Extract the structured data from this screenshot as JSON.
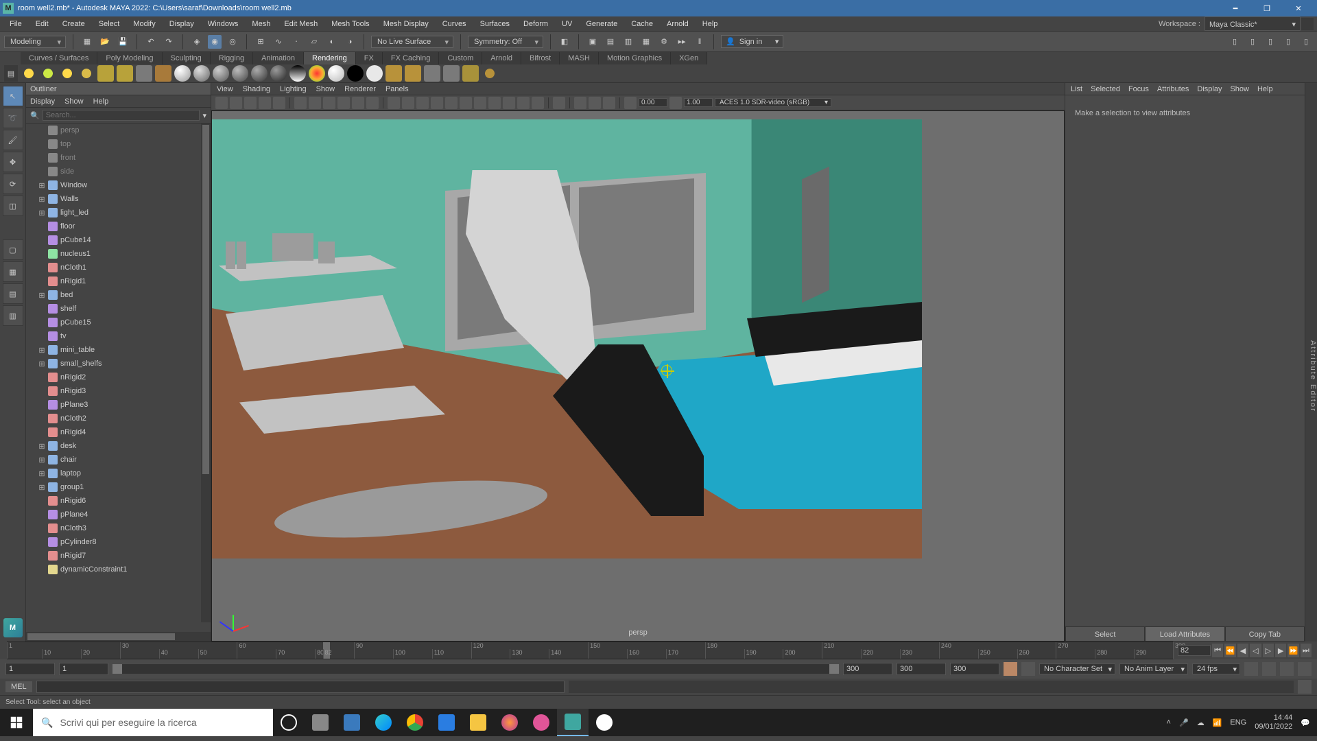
{
  "titlebar": {
    "title": "room well2.mb* - Autodesk MAYA 2022: C:\\Users\\saraf\\Downloads\\room well2.mb",
    "app_icon_letter": "M"
  },
  "menus": [
    "File",
    "Edit",
    "Create",
    "Select",
    "Modify",
    "Display",
    "Windows",
    "Mesh",
    "Edit Mesh",
    "Mesh Tools",
    "Mesh Display",
    "Curves",
    "Surfaces",
    "Deform",
    "UV",
    "Generate",
    "Cache",
    "Arnold",
    "Help"
  ],
  "workspace": {
    "label": "Workspace :",
    "value": "Maya Classic*"
  },
  "statusline": {
    "mode": "Modeling",
    "live": "No Live Surface",
    "symmetry": "Symmetry: Off",
    "signin": "Sign in"
  },
  "shelf_tabs": [
    "Curves / Surfaces",
    "Poly Modeling",
    "Sculpting",
    "Rigging",
    "Animation",
    "Rendering",
    "FX",
    "FX Caching",
    "Custom",
    "Arnold",
    "Bifrost",
    "MASH",
    "Motion Graphics",
    "XGen"
  ],
  "shelf_active_idx": 5,
  "outliner": {
    "title": "Outliner",
    "menus": [
      "Display",
      "Show",
      "Help"
    ],
    "search_placeholder": "Search...",
    "nodes": [
      {
        "exp": "",
        "cls": "cam",
        "name": "persp"
      },
      {
        "exp": "",
        "cls": "cam",
        "name": "top"
      },
      {
        "exp": "",
        "cls": "cam",
        "name": "front"
      },
      {
        "exp": "",
        "cls": "cam",
        "name": "side"
      },
      {
        "exp": "⊞",
        "cls": "grp",
        "name": "Window"
      },
      {
        "exp": "⊞",
        "cls": "grp",
        "name": "Walls"
      },
      {
        "exp": "⊞",
        "cls": "grp",
        "name": "light_led"
      },
      {
        "exp": "",
        "cls": "mesh",
        "name": "floor"
      },
      {
        "exp": "",
        "cls": "mesh",
        "name": "pCube14"
      },
      {
        "exp": "",
        "cls": "nuc",
        "name": "nucleus1"
      },
      {
        "exp": "",
        "cls": "phys",
        "name": "nCloth1"
      },
      {
        "exp": "",
        "cls": "phys",
        "name": "nRigid1"
      },
      {
        "exp": "⊞",
        "cls": "grp",
        "name": "bed"
      },
      {
        "exp": "",
        "cls": "mesh",
        "name": "shelf"
      },
      {
        "exp": "",
        "cls": "mesh",
        "name": "pCube15"
      },
      {
        "exp": "",
        "cls": "mesh",
        "name": "tv"
      },
      {
        "exp": "⊞",
        "cls": "grp",
        "name": "mini_table"
      },
      {
        "exp": "⊞",
        "cls": "grp",
        "name": "small_shelfs"
      },
      {
        "exp": "",
        "cls": "phys",
        "name": "nRigid2"
      },
      {
        "exp": "",
        "cls": "phys",
        "name": "nRigid3"
      },
      {
        "exp": "",
        "cls": "mesh",
        "name": "pPlane3"
      },
      {
        "exp": "",
        "cls": "phys",
        "name": "nCloth2"
      },
      {
        "exp": "",
        "cls": "phys",
        "name": "nRigid4"
      },
      {
        "exp": "⊞",
        "cls": "grp",
        "name": "desk"
      },
      {
        "exp": "⊞",
        "cls": "grp",
        "name": "chair"
      },
      {
        "exp": "⊞",
        "cls": "grp",
        "name": "laptop"
      },
      {
        "exp": "⊞",
        "cls": "grp",
        "name": "group1"
      },
      {
        "exp": "",
        "cls": "phys",
        "name": "nRigid6"
      },
      {
        "exp": "",
        "cls": "mesh",
        "name": "pPlane4"
      },
      {
        "exp": "",
        "cls": "phys",
        "name": "nCloth3"
      },
      {
        "exp": "",
        "cls": "mesh",
        "name": "pCylinder8"
      },
      {
        "exp": "",
        "cls": "phys",
        "name": "nRigid7"
      },
      {
        "exp": "",
        "cls": "dyn",
        "name": "dynamicConstraint1"
      }
    ]
  },
  "viewport": {
    "menus": [
      "View",
      "Shading",
      "Lighting",
      "Show",
      "Renderer",
      "Panels"
    ],
    "num1": "0.00",
    "num2": "1.00",
    "colorspace": "ACES 1.0 SDR-video (sRGB)",
    "camera": "persp"
  },
  "attr": {
    "menus": [
      "List",
      "Selected",
      "Focus",
      "Attributes",
      "Display",
      "Show",
      "Help"
    ],
    "msg": "Make a selection to view attributes",
    "btn_select": "Select",
    "btn_load": "Load Attributes",
    "btn_copy": "Copy Tab",
    "side_label": "Attribute Editor"
  },
  "timeline": {
    "ticks": [
      1,
      30,
      60,
      90,
      120,
      150,
      180,
      210,
      240,
      270,
      300
    ],
    "sub_ticks": [
      10,
      20,
      40,
      50,
      70,
      80,
      82,
      100,
      110,
      130,
      140,
      160,
      170,
      190,
      200,
      220,
      230,
      250,
      260,
      280,
      290
    ],
    "current": 82,
    "range_start_outer": "1",
    "range_start_inner": "1",
    "range_end_inner": "300",
    "range_end_outer": "300",
    "range_end_outer2": "300",
    "charset": "No Character Set",
    "animlayer": "No Anim Layer",
    "fps": "24 fps"
  },
  "cmd": {
    "lang": "MEL"
  },
  "help_line": "Select Tool: select an object",
  "taskbar": {
    "search_placeholder": "Scrivi qui per eseguire la ricerca",
    "lang": "ENG",
    "time": "14:44",
    "date": "09/01/2022"
  }
}
